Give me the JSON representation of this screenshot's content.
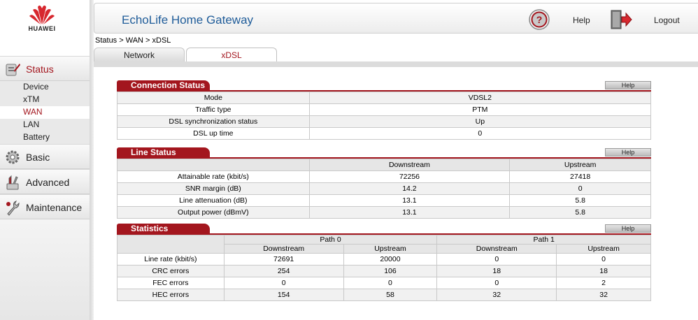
{
  "brand": {
    "name": "HUAWEI",
    "color": "#d7282f"
  },
  "header": {
    "title": "EchoLife Home Gateway",
    "help": "Help",
    "logout": "Logout",
    "help_icon": "question-circle-icon",
    "logout_icon": "door-exit-icon"
  },
  "breadcrumb": "Status > WAN > xDSL",
  "tabs": [
    {
      "label": "Network",
      "active": false
    },
    {
      "label": "xDSL",
      "active": true
    }
  ],
  "sidebar": {
    "status": {
      "label": "Status",
      "icon": "status-icon"
    },
    "status_items": [
      {
        "label": "Device"
      },
      {
        "label": "xTM"
      },
      {
        "label": "WAN",
        "active": true
      },
      {
        "label": "LAN"
      },
      {
        "label": "Battery"
      }
    ],
    "basic": {
      "label": "Basic",
      "icon": "gear-icon"
    },
    "advanced": {
      "label": "Advanced",
      "icon": "tools-icon"
    },
    "maintenance": {
      "label": "Maintenance",
      "icon": "wrench-icon"
    }
  },
  "connection_status": {
    "title": "Connection Status",
    "help": "Help",
    "rows": [
      {
        "label": "Mode",
        "value": "VDSL2"
      },
      {
        "label": "Traffic type",
        "value": "PTM"
      },
      {
        "label": "DSL synchronization status",
        "value": "Up"
      },
      {
        "label": "DSL up time",
        "value": "0"
      }
    ]
  },
  "line_status": {
    "title": "Line Status",
    "help": "Help",
    "columns": {
      "downstream": "Downstream",
      "upstream": "Upstream"
    },
    "rows": [
      {
        "label": "Attainable rate (kbit/s)",
        "down": "72256",
        "up": "27418"
      },
      {
        "label": "SNR margin (dB)",
        "down": "14.2",
        "up": "0"
      },
      {
        "label": "Line attenuation (dB)",
        "down": "13.1",
        "up": "5.8"
      },
      {
        "label": "Output power (dBmV)",
        "down": "13.1",
        "up": "5.8"
      }
    ]
  },
  "statistics": {
    "title": "Statistics",
    "help": "Help",
    "path0": "Path 0",
    "path1": "Path 1",
    "columns": {
      "downstream": "Downstream",
      "upstream": "Upstream"
    },
    "rows": [
      {
        "label": "Line rate (kbit/s)",
        "p0_down": "72691",
        "p0_up": "20000",
        "p1_down": "0",
        "p1_up": "0"
      },
      {
        "label": "CRC errors",
        "p0_down": "254",
        "p0_up": "106",
        "p1_down": "18",
        "p1_up": "18"
      },
      {
        "label": "FEC errors",
        "p0_down": "0",
        "p0_up": "0",
        "p1_down": "0",
        "p1_up": "2"
      },
      {
        "label": "HEC errors",
        "p0_down": "154",
        "p0_up": "58",
        "p1_down": "32",
        "p1_up": "32"
      }
    ]
  },
  "accent_color": "#a3161e"
}
